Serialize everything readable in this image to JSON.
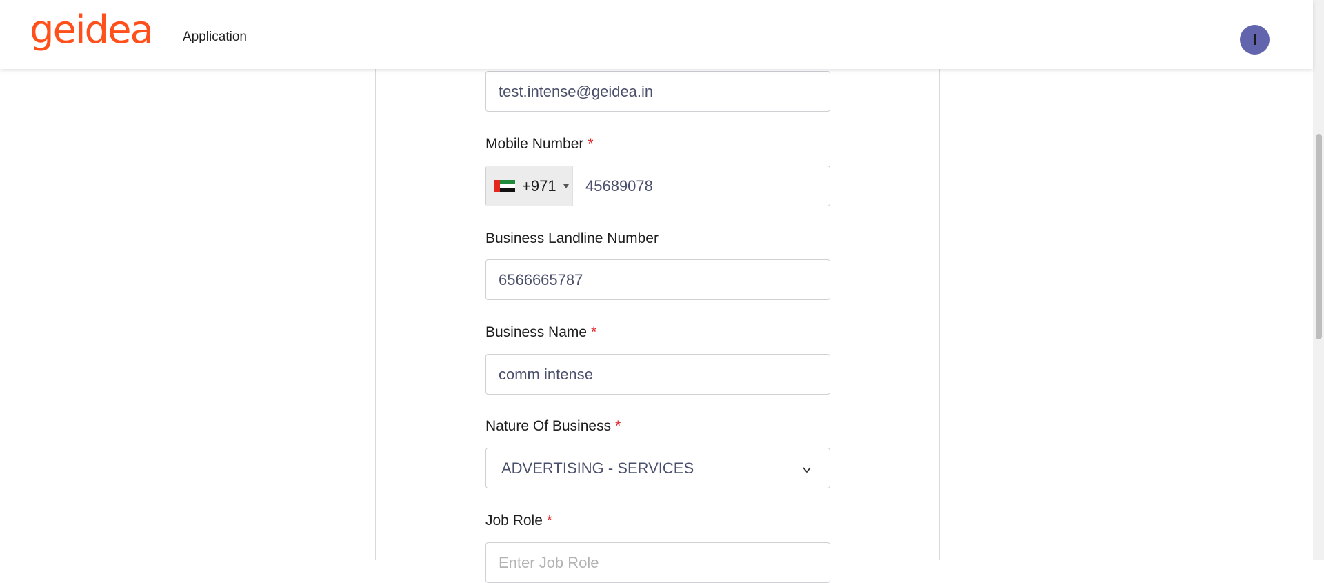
{
  "header": {
    "logo_text": "geidea",
    "logo_color": "#ff4f1a",
    "nav_item": "Application",
    "avatar_initial": "I",
    "avatar_color": "#6264ad"
  },
  "form": {
    "email": {
      "value": "test.intense@geidea.in"
    },
    "mobile": {
      "label": "Mobile Number",
      "required_mark": "*",
      "country_flag": "uae-flag-icon",
      "dial_code": "+971",
      "value": "45689078"
    },
    "landline": {
      "label": "Business Landline Number",
      "value": "6566665787"
    },
    "business_name": {
      "label": "Business Name",
      "required_mark": "*",
      "value": "comm intense"
    },
    "nature_of_business": {
      "label": "Nature Of Business",
      "required_mark": "*",
      "selected": "ADVERTISING - SERVICES"
    },
    "job_role": {
      "label": "Job Role",
      "required_mark": "*",
      "placeholder": "Enter Job Role"
    }
  }
}
